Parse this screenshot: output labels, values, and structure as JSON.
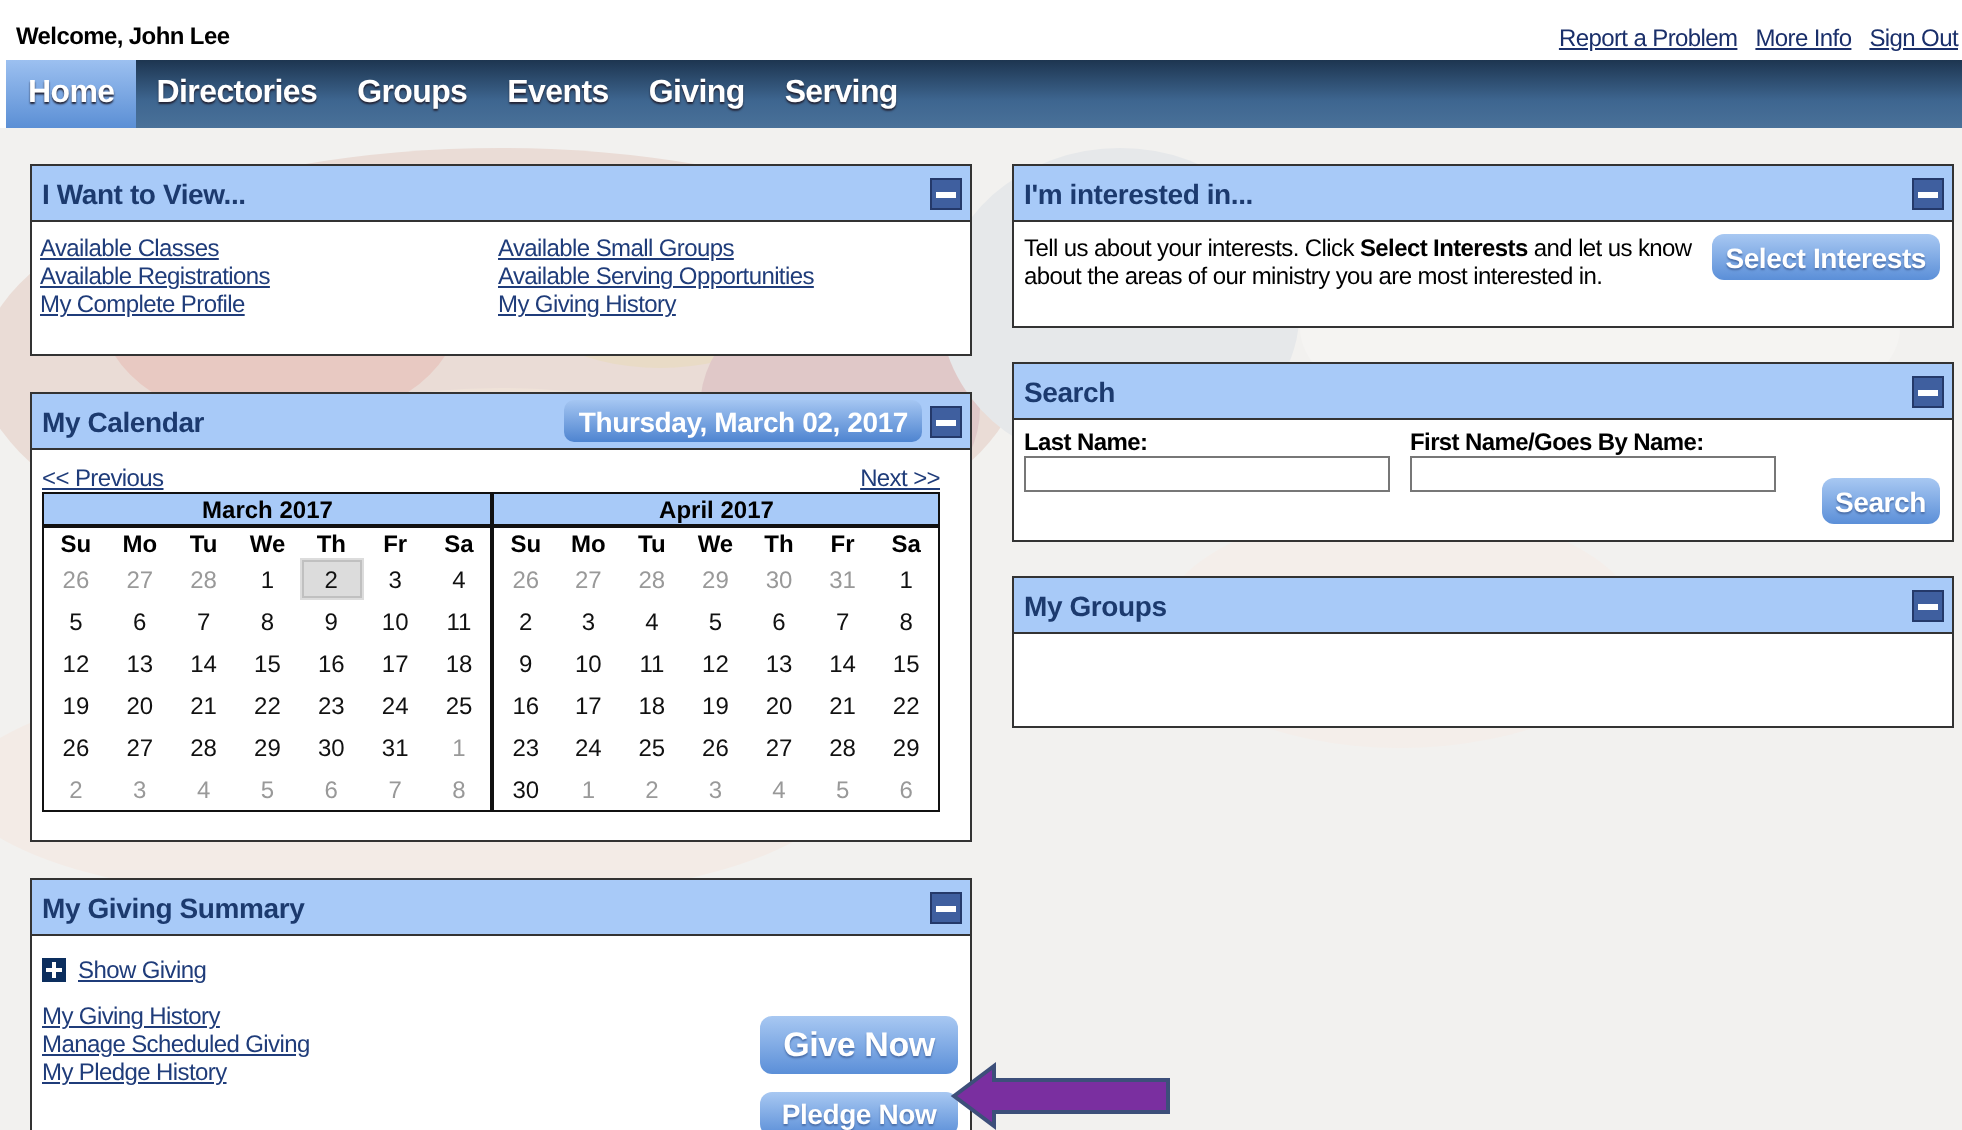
{
  "header": {
    "welcome": "Welcome, John Lee",
    "links": [
      "Report a Problem",
      "More Info",
      "Sign Out"
    ]
  },
  "nav": [
    {
      "label": "Home",
      "selected": true
    },
    {
      "label": "Directories",
      "selected": false
    },
    {
      "label": "Groups",
      "selected": false
    },
    {
      "label": "Events",
      "selected": false
    },
    {
      "label": "Giving",
      "selected": false
    },
    {
      "label": "Serving",
      "selected": false
    }
  ],
  "view_panel": {
    "title": "I Want to View...",
    "links": [
      "Available Classes",
      "Available Registrations",
      "My Complete Profile",
      "Available Small Groups",
      "Available Serving Opportunities",
      "My Giving History"
    ]
  },
  "calendar_panel": {
    "title": "My Calendar",
    "date_button": "Thursday, March 02, 2017",
    "previous": "<< Previous",
    "next": "Next >>",
    "months": [
      {
        "title": "March 2017",
        "weekdays": [
          "Su",
          "Mo",
          "Tu",
          "We",
          "Th",
          "Fr",
          "Sa"
        ],
        "weeks": [
          [
            {
              "text": "26",
              "outside": true,
              "selected": false
            },
            {
              "text": "27",
              "outside": true,
              "selected": false
            },
            {
              "text": "28",
              "outside": true,
              "selected": false
            },
            {
              "text": "1",
              "outside": false,
              "selected": false
            },
            {
              "text": "2",
              "outside": false,
              "selected": true
            },
            {
              "text": "3",
              "outside": false,
              "selected": false
            },
            {
              "text": "4",
              "outside": false,
              "selected": false
            }
          ],
          [
            {
              "text": "5",
              "outside": false,
              "selected": false
            },
            {
              "text": "6",
              "outside": false,
              "selected": false
            },
            {
              "text": "7",
              "outside": false,
              "selected": false
            },
            {
              "text": "8",
              "outside": false,
              "selected": false
            },
            {
              "text": "9",
              "outside": false,
              "selected": false
            },
            {
              "text": "10",
              "outside": false,
              "selected": false
            },
            {
              "text": "11",
              "outside": false,
              "selected": false
            }
          ],
          [
            {
              "text": "12",
              "outside": false,
              "selected": false
            },
            {
              "text": "13",
              "outside": false,
              "selected": false
            },
            {
              "text": "14",
              "outside": false,
              "selected": false
            },
            {
              "text": "15",
              "outside": false,
              "selected": false
            },
            {
              "text": "16",
              "outside": false,
              "selected": false
            },
            {
              "text": "17",
              "outside": false,
              "selected": false
            },
            {
              "text": "18",
              "outside": false,
              "selected": false
            }
          ],
          [
            {
              "text": "19",
              "outside": false,
              "selected": false
            },
            {
              "text": "20",
              "outside": false,
              "selected": false
            },
            {
              "text": "21",
              "outside": false,
              "selected": false
            },
            {
              "text": "22",
              "outside": false,
              "selected": false
            },
            {
              "text": "23",
              "outside": false,
              "selected": false
            },
            {
              "text": "24",
              "outside": false,
              "selected": false
            },
            {
              "text": "25",
              "outside": false,
              "selected": false
            }
          ],
          [
            {
              "text": "26",
              "outside": false,
              "selected": false
            },
            {
              "text": "27",
              "outside": false,
              "selected": false
            },
            {
              "text": "28",
              "outside": false,
              "selected": false
            },
            {
              "text": "29",
              "outside": false,
              "selected": false
            },
            {
              "text": "30",
              "outside": false,
              "selected": false
            },
            {
              "text": "31",
              "outside": false,
              "selected": false
            },
            {
              "text": "1",
              "outside": true,
              "selected": false
            }
          ],
          [
            {
              "text": "2",
              "outside": true,
              "selected": false
            },
            {
              "text": "3",
              "outside": true,
              "selected": false
            },
            {
              "text": "4",
              "outside": true,
              "selected": false
            },
            {
              "text": "5",
              "outside": true,
              "selected": false
            },
            {
              "text": "6",
              "outside": true,
              "selected": false
            },
            {
              "text": "7",
              "outside": true,
              "selected": false
            },
            {
              "text": "8",
              "outside": true,
              "selected": false
            }
          ]
        ]
      },
      {
        "title": "April 2017",
        "weekdays": [
          "Su",
          "Mo",
          "Tu",
          "We",
          "Th",
          "Fr",
          "Sa"
        ],
        "weeks": [
          [
            {
              "text": "26",
              "outside": true,
              "selected": false
            },
            {
              "text": "27",
              "outside": true,
              "selected": false
            },
            {
              "text": "28",
              "outside": true,
              "selected": false
            },
            {
              "text": "29",
              "outside": true,
              "selected": false
            },
            {
              "text": "30",
              "outside": true,
              "selected": false
            },
            {
              "text": "31",
              "outside": true,
              "selected": false
            },
            {
              "text": "1",
              "outside": false,
              "selected": false
            }
          ],
          [
            {
              "text": "2",
              "outside": false,
              "selected": false
            },
            {
              "text": "3",
              "outside": false,
              "selected": false
            },
            {
              "text": "4",
              "outside": false,
              "selected": false
            },
            {
              "text": "5",
              "outside": false,
              "selected": false
            },
            {
              "text": "6",
              "outside": false,
              "selected": false
            },
            {
              "text": "7",
              "outside": false,
              "selected": false
            },
            {
              "text": "8",
              "outside": false,
              "selected": false
            }
          ],
          [
            {
              "text": "9",
              "outside": false,
              "selected": false
            },
            {
              "text": "10",
              "outside": false,
              "selected": false
            },
            {
              "text": "11",
              "outside": false,
              "selected": false
            },
            {
              "text": "12",
              "outside": false,
              "selected": false
            },
            {
              "text": "13",
              "outside": false,
              "selected": false
            },
            {
              "text": "14",
              "outside": false,
              "selected": false
            },
            {
              "text": "15",
              "outside": false,
              "selected": false
            }
          ],
          [
            {
              "text": "16",
              "outside": false,
              "selected": false
            },
            {
              "text": "17",
              "outside": false,
              "selected": false
            },
            {
              "text": "18",
              "outside": false,
              "selected": false
            },
            {
              "text": "19",
              "outside": false,
              "selected": false
            },
            {
              "text": "20",
              "outside": false,
              "selected": false
            },
            {
              "text": "21",
              "outside": false,
              "selected": false
            },
            {
              "text": "22",
              "outside": false,
              "selected": false
            }
          ],
          [
            {
              "text": "23",
              "outside": false,
              "selected": false
            },
            {
              "text": "24",
              "outside": false,
              "selected": false
            },
            {
              "text": "25",
              "outside": false,
              "selected": false
            },
            {
              "text": "26",
              "outside": false,
              "selected": false
            },
            {
              "text": "27",
              "outside": false,
              "selected": false
            },
            {
              "text": "28",
              "outside": false,
              "selected": false
            },
            {
              "text": "29",
              "outside": false,
              "selected": false
            }
          ],
          [
            {
              "text": "30",
              "outside": false,
              "selected": false
            },
            {
              "text": "1",
              "outside": true,
              "selected": false
            },
            {
              "text": "2",
              "outside": true,
              "selected": false
            },
            {
              "text": "3",
              "outside": true,
              "selected": false
            },
            {
              "text": "4",
              "outside": true,
              "selected": false
            },
            {
              "text": "5",
              "outside": true,
              "selected": false
            },
            {
              "text": "6",
              "outside": true,
              "selected": false
            }
          ]
        ]
      }
    ]
  },
  "giving_panel": {
    "title": "My Giving Summary",
    "show_giving": {
      "label": "Show Giving",
      "expanded": false
    },
    "links": [
      "My Giving History",
      "Manage Scheduled Giving",
      "My Pledge History"
    ],
    "buttons": [
      "Give Now",
      "Pledge Now"
    ]
  },
  "interest_panel": {
    "title": "I'm interested in...",
    "text": "Tell us about your interests. Click **Select Interests** and let us know about the areas of our ministry you are most interested in.",
    "button": "Select Interests"
  },
  "search_panel": {
    "title": "Search",
    "fields": [
      {
        "label": "Last Name:"
      },
      {
        "label": "First Name/Goes By Name:"
      }
    ],
    "button": "Search"
  },
  "groups_panel": {
    "title": "My Groups"
  }
}
